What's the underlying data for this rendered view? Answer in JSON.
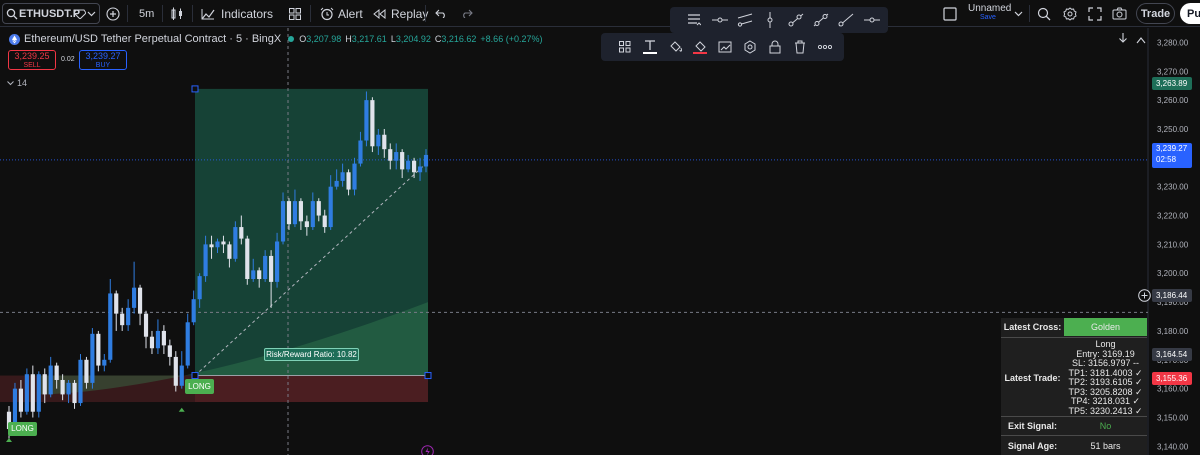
{
  "toolbar": {
    "symbol": "ETHUSDT.P",
    "interval": "5m",
    "indicators_label": "Indicators",
    "alert_label": "Alert",
    "replay_label": "Replay",
    "layout_name": "Unnamed",
    "layout_status": "Save",
    "trade_label": "Trade",
    "publish_label": "Pu"
  },
  "legend": {
    "title": "Ethereum/USD Tether Perpetual Contract · 5 · BingX",
    "open_key": "O",
    "open_value": "3,207.98",
    "high_key": "H",
    "high_value": "3,217.61",
    "low_key": "L",
    "low_value": "3,204.92",
    "close_key": "C",
    "close_value": "3,216.62",
    "change": "+8.66 (+0.27%)",
    "sell_price": "3,239.25",
    "sell_label": "SELL",
    "spread": "0.02",
    "buy_price": "3,239.27",
    "buy_label": "BUY",
    "indicator_count": "14"
  },
  "colors": {
    "up": "#2f7de1",
    "down": "#e0e3eb",
    "profit_zone": "#1e6e58",
    "loss_zone": "#5a2226",
    "accent_green": "#4caf50",
    "price_line": "#2962ff",
    "stop_label": "#f23645"
  },
  "drawing_toolbar": {
    "icons": [
      "grip-icon",
      "text-icon",
      "fill-color-icon",
      "pen-color-icon",
      "add-to-chart-icon",
      "settings-icon",
      "lock-icon",
      "trash-icon",
      "more-icon"
    ]
  },
  "drawing_tools": {
    "icons": [
      "tool-menu-icon",
      "horizontal-line-icon",
      "trend-channel-icon",
      "vertical-line-icon",
      "ray-icon",
      "trend-line-icon",
      "extended-line-icon",
      "horizontal-ray-icon"
    ]
  },
  "chart_data": {
    "type": "candlestick",
    "symbol": "ETHUSDT.P",
    "exchange": "BingX",
    "interval": "5",
    "ylim": [
      3137,
      3285
    ],
    "y_ticks": [
      3280,
      3270,
      3260,
      3250,
      3240,
      3230,
      3220,
      3210,
      3200,
      3190,
      3180,
      3170,
      3160,
      3150,
      3140
    ],
    "y_tick_labels": [
      "3,280.00",
      "3,270.00",
      "3,260.00",
      "3,250.00",
      "3,240.00",
      "3,230.00",
      "3,220.00",
      "3,210.00",
      "3,200.00",
      "3,190.00",
      "3,180.00",
      "3,170.00",
      "3,160.00",
      "3,150.00",
      "3,140.00"
    ],
    "candles": [
      [
        3152,
        3146,
        3154,
        3142
      ],
      [
        3146,
        3160,
        3162,
        3144
      ],
      [
        3160,
        3152,
        3163,
        3150
      ],
      [
        3152,
        3165,
        3167,
        3151
      ],
      [
        3165,
        3152,
        3168,
        3150
      ],
      [
        3152,
        3165,
        3166,
        3150
      ],
      [
        3165,
        3158,
        3167,
        3155
      ],
      [
        3158,
        3168,
        3171,
        3157
      ],
      [
        3168,
        3163,
        3169,
        3160
      ],
      [
        3163,
        3158,
        3165,
        3156
      ],
      [
        3158,
        3162,
        3163,
        3155
      ],
      [
        3162,
        3155,
        3163,
        3153
      ],
      [
        3155,
        3170,
        3172,
        3154
      ],
      [
        3170,
        3162,
        3171,
        3160
      ],
      [
        3162,
        3179,
        3181,
        3160
      ],
      [
        3179,
        3168,
        3180,
        3166
      ],
      [
        3168,
        3170,
        3172,
        3166
      ],
      [
        3170,
        3193,
        3198,
        3169
      ],
      [
        3193,
        3186,
        3194,
        3180
      ],
      [
        3186,
        3182,
        3188,
        3180
      ],
      [
        3182,
        3188,
        3191,
        3180
      ],
      [
        3188,
        3195,
        3204,
        3186
      ],
      [
        3195,
        3186,
        3196,
        3182
      ],
      [
        3186,
        3178,
        3187,
        3174
      ],
      [
        3178,
        3174,
        3180,
        3172
      ],
      [
        3174,
        3180,
        3184,
        3172
      ],
      [
        3180,
        3175,
        3182,
        3172
      ],
      [
        3175,
        3171,
        3177,
        3168
      ],
      [
        3171,
        3161,
        3173,
        3159
      ],
      [
        3161,
        3168,
        3173,
        3160
      ],
      [
        3168,
        3183,
        3186,
        3167
      ],
      [
        3183,
        3191,
        3194,
        3182
      ],
      [
        3191,
        3199,
        3200,
        3188
      ],
      [
        3199,
        3210,
        3213,
        3197
      ],
      [
        3210,
        3209,
        3213,
        3205
      ],
      [
        3209,
        3211,
        3212,
        3207
      ],
      [
        3211,
        3210,
        3213,
        3207
      ],
      [
        3210,
        3205,
        3211,
        3202
      ],
      [
        3205,
        3216,
        3218,
        3204
      ],
      [
        3216,
        3212,
        3220,
        3210
      ],
      [
        3212,
        3198,
        3213,
        3196
      ],
      [
        3198,
        3201,
        3205,
        3197
      ],
      [
        3201,
        3198,
        3202,
        3195
      ],
      [
        3198,
        3206,
        3208,
        3197
      ],
      [
        3206,
        3197,
        3208,
        3188
      ],
      [
        3197,
        3211,
        3214,
        3195
      ],
      [
        3211,
        3225,
        3228,
        3210
      ],
      [
        3225,
        3217,
        3226,
        3215
      ],
      [
        3217,
        3225,
        3229,
        3216
      ],
      [
        3225,
        3218,
        3226,
        3215
      ],
      [
        3218,
        3216,
        3220,
        3213
      ],
      [
        3216,
        3225,
        3228,
        3215
      ],
      [
        3225,
        3220,
        3226,
        3218
      ],
      [
        3220,
        3216,
        3222,
        3214
      ],
      [
        3216,
        3230,
        3234,
        3215
      ],
      [
        3230,
        3232,
        3236,
        3229
      ],
      [
        3232,
        3235,
        3238,
        3230
      ],
      [
        3235,
        3229,
        3236,
        3227
      ],
      [
        3229,
        3238,
        3240,
        3227
      ],
      [
        3238,
        3246,
        3249,
        3237
      ],
      [
        3246,
        3260,
        3263,
        3244
      ],
      [
        3260,
        3244,
        3261,
        3242
      ],
      [
        3244,
        3248,
        3250,
        3241
      ],
      [
        3248,
        3243,
        3250,
        3240
      ],
      [
        3243,
        3239,
        3245,
        3236
      ],
      [
        3239,
        3242,
        3245,
        3236
      ],
      [
        3242,
        3236,
        3243,
        3233
      ],
      [
        3236,
        3239,
        3241,
        3235
      ],
      [
        3239,
        3235,
        3240,
        3233
      ],
      [
        3235,
        3237,
        3240,
        3232
      ],
      [
        3237,
        3241,
        3243,
        3235
      ]
    ],
    "series": [
      {
        "name": "Exponential MA band",
        "type": "area"
      }
    ],
    "long_position": {
      "entry": 3164.54,
      "target": 3263.89,
      "stop": 3155.36,
      "ratio_label": "Risk/Reward Ratio: 10.82"
    },
    "current_price": "3,239.27",
    "countdown": "02:58",
    "crosshair_price": "3,186.44",
    "axis_labels": {
      "target": "3,263.89",
      "entry": "3,164.54",
      "stop": "3,155.36"
    },
    "signals": [
      {
        "label": "LONG",
        "position": "first"
      },
      {
        "label": "LONG",
        "position": "entry"
      }
    ]
  },
  "info_table": {
    "rows": [
      {
        "label": "Latest Cross:",
        "value": "Golden"
      },
      {
        "label": "Latest Trade:",
        "lines": [
          "Long",
          "Entry: 3169.19",
          "SL: 3156.9797 --",
          "TP1: 3181.4003 ✓",
          "TP2: 3193.6105 ✓",
          "TP3: 3205.8208 ✓",
          "TP4: 3218.031 ✓",
          "TP5: 3230.2413 ✓"
        ]
      },
      {
        "label": "Exit Signal:",
        "value": "No"
      },
      {
        "label": "Signal Age:",
        "value": "51 bars"
      }
    ]
  }
}
